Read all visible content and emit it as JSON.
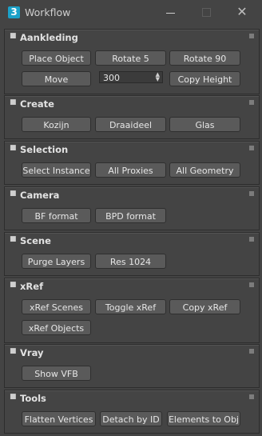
{
  "window": {
    "icon_glyph": "3",
    "title": "Workflow",
    "controls": {
      "min_icon": "minimize-icon",
      "max_icon": "maximize-icon",
      "close_icon": "close-icon",
      "close_glyph": "✕"
    }
  },
  "panels": [
    {
      "title": "Aankleding",
      "toggle": "■",
      "buttons": [
        "Place Object",
        "Rotate 5",
        "Rotate 90",
        "Move",
        "Copy Height"
      ],
      "spinner": {
        "value": "300"
      }
    },
    {
      "title": "Create",
      "toggle": "■",
      "buttons": [
        "Kozijn",
        "Draaideel",
        "Glas"
      ]
    },
    {
      "title": "Selection",
      "toggle": "■",
      "buttons": [
        "Select Instance",
        "All Proxies",
        "All Geometry"
      ]
    },
    {
      "title": "Camera",
      "toggle": "■",
      "buttons": [
        "BF format",
        "BPD format"
      ]
    },
    {
      "title": "Scene",
      "toggle": "■",
      "buttons": [
        "Purge Layers",
        "Res 1024"
      ]
    },
    {
      "title": "xRef",
      "toggle": "■",
      "buttons": [
        "xRef Scenes",
        "Toggle xRef",
        "Copy xRef",
        "xRef Objects"
      ]
    },
    {
      "title": "Vray",
      "toggle": "■",
      "buttons": [
        "Show VFB"
      ]
    },
    {
      "title": "Tools",
      "toggle": "■",
      "buttons": [
        "Flatten Vertices",
        "Detach by ID",
        "Elements to Obj"
      ]
    }
  ]
}
